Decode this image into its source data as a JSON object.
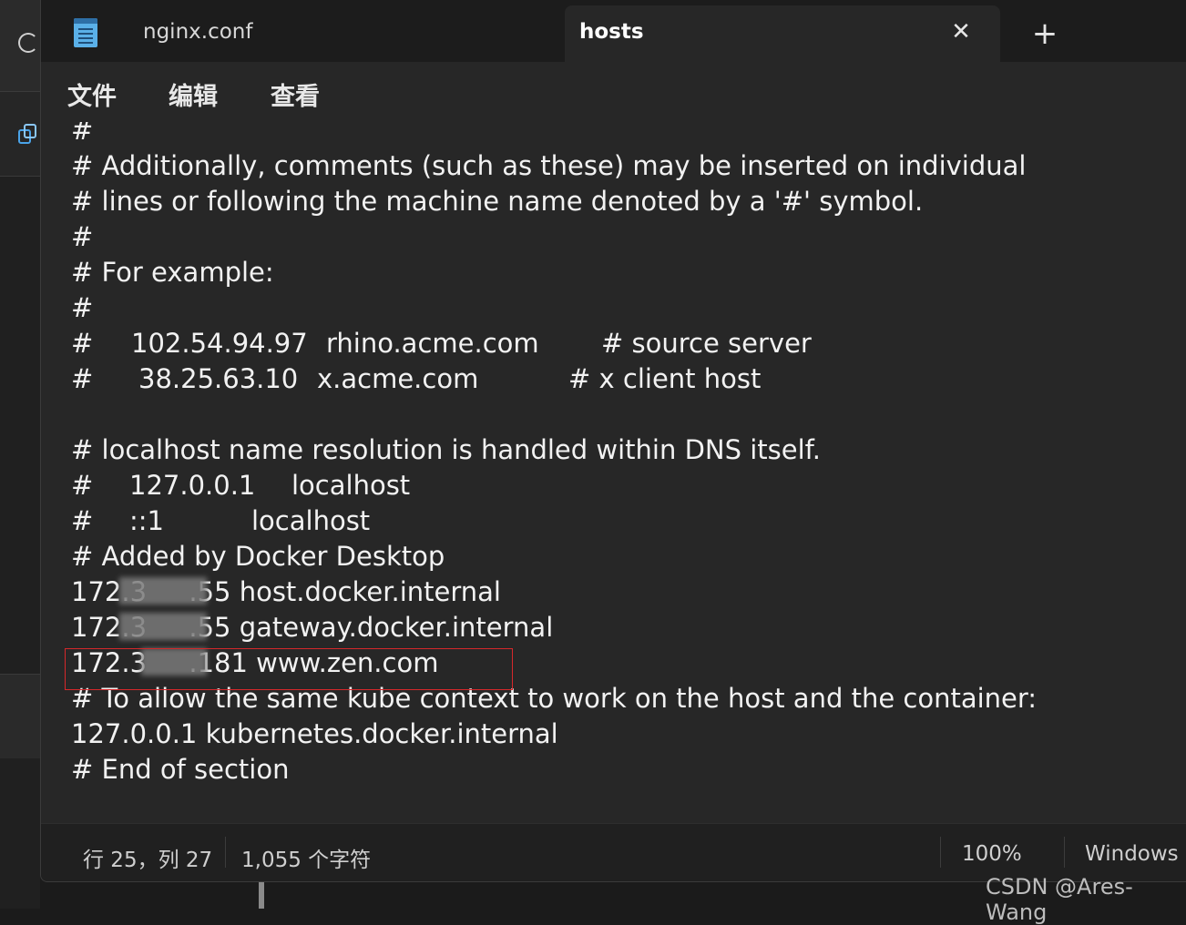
{
  "tabs": {
    "inactive_label": "nginx.conf",
    "active_label": "hosts",
    "close_symbol": "✕",
    "new_tab_symbol": "+"
  },
  "menu": {
    "file": "文件",
    "edit": "编辑",
    "view": "查看"
  },
  "editor": {
    "lines": [
      {
        "text": "#"
      },
      {
        "text": "# Additionally, comments (such as these) may be inserted on individual"
      },
      {
        "text": "# lines or following the machine name denoted by a '#' symbol."
      },
      {
        "text": "#"
      },
      {
        "text": "# For example:"
      },
      {
        "text": "#"
      },
      {
        "cols": [
          "#",
          "102.54.94.97",
          "rhino.acme.com",
          "# source server"
        ]
      },
      {
        "cols": [
          "#",
          "38.25.63.10",
          "x.acme.com",
          "# x client host"
        ]
      },
      {
        "text": ""
      },
      {
        "text": "# localhost name resolution is handled within DNS itself."
      },
      {
        "cols": [
          "#",
          "127.0.0.1",
          "localhost"
        ]
      },
      {
        "cols": [
          "#",
          "::1",
          "localhost"
        ]
      },
      {
        "text": "# Added by Docker Desktop"
      },
      {
        "text": "172.3        .55 host.docker.internal"
      },
      {
        "text": "172.3        .55 gateway.docker.internal"
      },
      {
        "text": "172.3        .181 www.zen.com"
      },
      {
        "text": "# To allow the same kube context to work on the host and the container:"
      },
      {
        "text": "127.0.0.1 kubernetes.docker.internal"
      },
      {
        "text": "# End of section"
      }
    ]
  },
  "status": {
    "position": "行 25，列 27",
    "char_count": "1,055 个字符",
    "zoom": "100%",
    "line_ending": "Windows ("
  },
  "watermark": "CSDN @Ares-Wang",
  "icons": [
    "refresh-icon",
    "copy-icon",
    "notepad-icon",
    "close-icon",
    "plus-icon"
  ],
  "colors": {
    "background": "#272727",
    "titlebar": "#1c1c1c",
    "highlight": "#d6282b",
    "text": "#f2f2f2"
  }
}
